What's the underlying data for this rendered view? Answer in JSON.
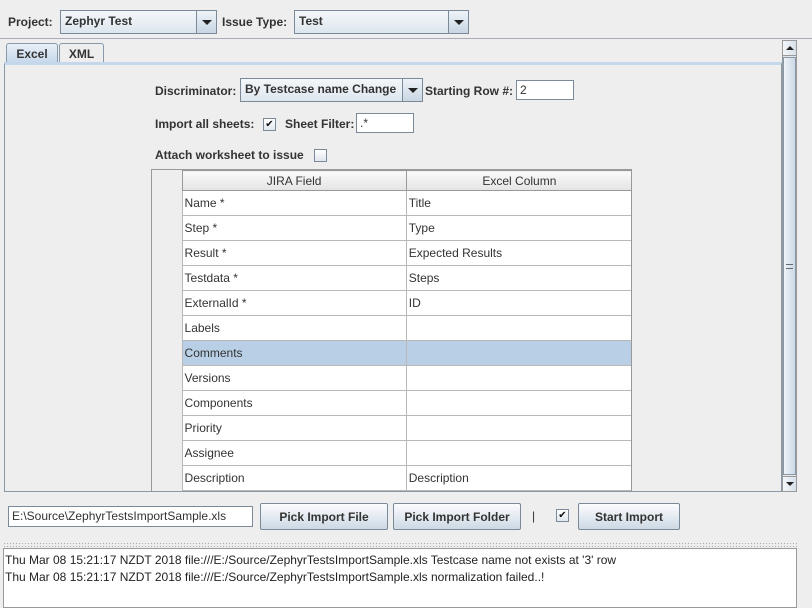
{
  "top": {
    "project_label": "Project:",
    "project_value": "Zephyr Test",
    "issue_type_label": "Issue Type:",
    "issue_type_value": "Test"
  },
  "tabs": [
    {
      "label": "Excel",
      "active": true
    },
    {
      "label": "XML",
      "active": false
    }
  ],
  "excel": {
    "discriminator_label": "Discriminator:",
    "discriminator_value": "By Testcase name Change",
    "starting_row_label": "Starting Row #:",
    "starting_row_value": "2",
    "import_all_label": "Import all sheets:",
    "import_all_checked": true,
    "sheet_filter_label": "Sheet Filter:",
    "sheet_filter_value": ".*",
    "attach_label": "Attach worksheet to issue",
    "attach_checked": false,
    "table": {
      "headers": [
        "JIRA Field",
        "Excel Column"
      ],
      "rows": [
        {
          "field": "Name *",
          "column": "Title"
        },
        {
          "field": "Step *",
          "column": "Type"
        },
        {
          "field": "Result *",
          "column": "Expected Results"
        },
        {
          "field": "Testdata *",
          "column": "Steps"
        },
        {
          "field": "ExternalId *",
          "column": "ID"
        },
        {
          "field": "Labels",
          "column": ""
        },
        {
          "field": "Comments",
          "column": "",
          "selected": true
        },
        {
          "field": "Versions",
          "column": ""
        },
        {
          "field": "Components",
          "column": ""
        },
        {
          "field": "Priority",
          "column": ""
        },
        {
          "field": "Assignee",
          "column": ""
        },
        {
          "field": "Description",
          "column": "Description"
        }
      ]
    }
  },
  "bottom": {
    "file_path": "E:\\Source\\ZephyrTestsImportSample.xls",
    "pick_file_label": "Pick Import File",
    "pick_folder_label": "Pick Import Folder",
    "separator": "|",
    "option_checked": true,
    "start_import_label": "Start Import"
  },
  "log": [
    "Thu Mar 08 15:21:17 NZDT 2018 file:///E:/Source/ZephyrTestsImportSample.xls Testcase name not exists at '3' row",
    "Thu Mar 08 15:21:17 NZDT 2018 file:///E:/Source/ZephyrTestsImportSample.xls normalization failed..!"
  ]
}
